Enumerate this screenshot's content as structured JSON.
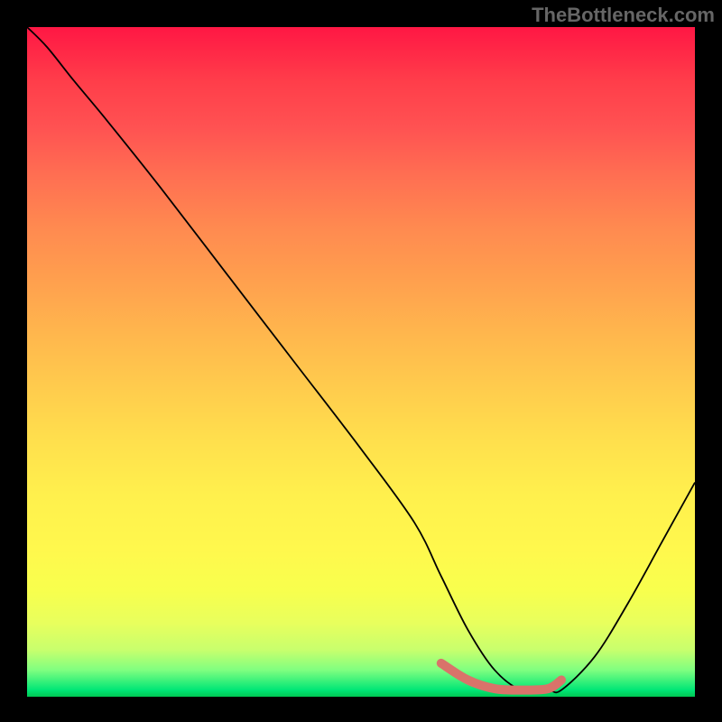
{
  "watermark": "TheBottleneck.com",
  "chart_data": {
    "type": "line",
    "title": "",
    "xlabel": "",
    "ylabel": "",
    "xlim": [
      0,
      100
    ],
    "ylim": [
      0,
      100
    ],
    "series": [
      {
        "name": "bottleneck-curve",
        "x": [
          0,
          3,
          7,
          12,
          20,
          30,
          40,
          50,
          58,
          62,
          66,
          70,
          74,
          78,
          80,
          85,
          90,
          95,
          100
        ],
        "y": [
          100,
          97,
          92,
          86,
          76,
          63,
          50,
          37,
          26,
          18,
          10,
          4,
          1,
          1,
          1,
          6,
          14,
          23,
          32
        ]
      },
      {
        "name": "optimal-region",
        "x": [
          62,
          66,
          70,
          74,
          78,
          80
        ],
        "y": [
          5,
          2.5,
          1.2,
          1,
          1.2,
          2.5
        ]
      }
    ],
    "annotations": []
  },
  "colors": {
    "curve": "#000000",
    "optimal_marker": "#d9736a",
    "background_top": "#ff1744",
    "background_bottom": "#00c853"
  }
}
